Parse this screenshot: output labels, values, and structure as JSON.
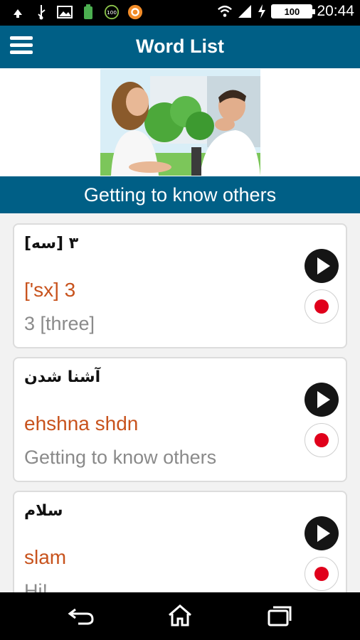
{
  "status_bar": {
    "time": "20:44",
    "battery_level": "100",
    "left_icons": [
      "usb-debug-icon",
      "usb-icon",
      "image-icon",
      "battery-saver-icon",
      "badge-100-icon",
      "notification-app-icon"
    ],
    "right_icons": [
      "wifi-icon",
      "signal-icon",
      "charging-icon"
    ]
  },
  "app_bar": {
    "title": "Word List",
    "menu_icon": "hamburger-menu-icon"
  },
  "hero_image": {
    "description_icon": "couple-photo"
  },
  "category": {
    "title": "Getting to know others"
  },
  "words": [
    {
      "native": "۳ [سه]",
      "transliteration": "['sx] 3",
      "meaning": "3 [three]"
    },
    {
      "native": "آشنا شدن",
      "transliteration": "ehshna shdn",
      "meaning": "Getting to know others"
    },
    {
      "native": "سلام",
      "transliteration": "slam",
      "meaning": "Hi!"
    }
  ],
  "colors": {
    "primary": "#005f86",
    "transliteration": "#c8531d",
    "meaning": "#8a8a8a",
    "record_dot": "#e0001b"
  },
  "nav_bar": {
    "icons": [
      "back-icon",
      "home-icon",
      "recent-apps-icon"
    ]
  }
}
